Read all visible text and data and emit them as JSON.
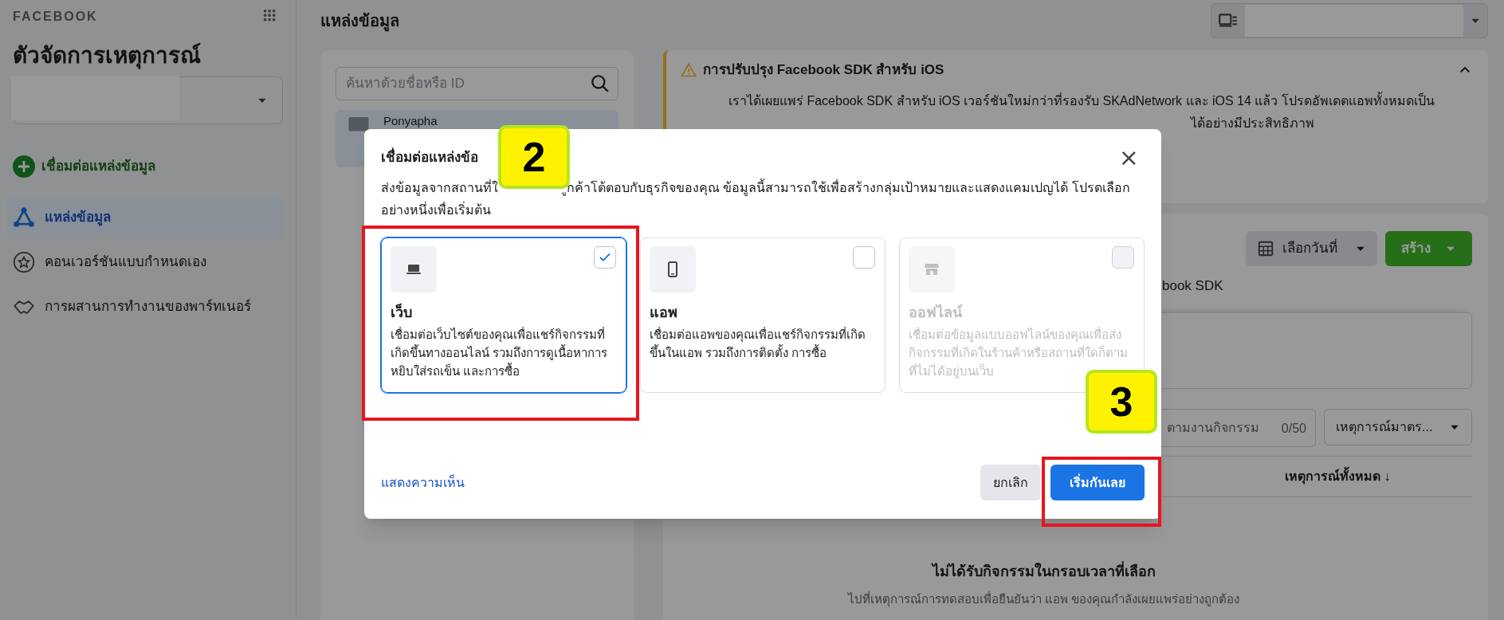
{
  "sidebar": {
    "brand": "FACEBOOK",
    "title": "ตัวจัดการเหตุการณ์",
    "connect_button": "เชื่อมต่อแหล่งข้อมูล",
    "items": [
      {
        "label": "แหล่งข้อมูล",
        "selected": true
      },
      {
        "label": "คอนเวอร์ชันแบบกำหนดเอง",
        "selected": false
      },
      {
        "label": "การผสานการทำงานของพาร์ทเนอร์",
        "selected": false
      }
    ]
  },
  "header": {
    "title": "แหล่งข้อมูล"
  },
  "sources_panel": {
    "search_placeholder": "ค้นหาด้วยชื่อหรือ ID",
    "items": [
      {
        "name": "Ponyapha",
        "selected": true
      }
    ]
  },
  "notice": {
    "title": "การปรับปรุง Facebook SDK สำหรับ iOS",
    "expanded": true,
    "lines": [
      "เราได้เผยแพร่ Facebook SDK สำหรับ iOS เวอร์ชันใหม่กว่าที่รองรับ SKAdNetwork และ iOS 14 แล้ว โปรดอัพเดตแอพทั้งหมดเป็น",
      "ได้อย่างมีประสิทธิภาพ"
    ]
  },
  "toolbar": {
    "date_button": "เลือกวันที่",
    "create_button": "สร้าง"
  },
  "details": {
    "tail_text": "book SDK"
  },
  "activity": {
    "search_placeholder": "ตามงานกิจกรรม",
    "counter": "0/50",
    "filter": "เหตุการณ์มาตร...",
    "column": "เหตุการณ์ทั้งหมด ↓",
    "empty_title": "ไม่ได้รับกิจกรรมในกรอบเวลาที่เลือก",
    "empty_text": "ไปที่เหตุการณ์การทดสอบเพื่อยืนยันว่า แอพ ของคุณกำลังเผยแพร่อย่างถูกต้อง"
  },
  "modal": {
    "title": "เชื่อมต่อแหล่งข้อ",
    "close": "×",
    "description": [
      "ส่งข้อมูลจากสถานที่ใ",
      "ูกค้าโต้ตอบกับธุรกิจของคุณ ข้อมูลนี้สามารถใช้เพื่อสร้างกลุ่มเป้าหมายและแสดงแคมเปญได้ โปรดเลือก",
      "อย่างหนึ่งเพื่อเริ่มต้น"
    ],
    "options": [
      {
        "title": "เว็บ",
        "description": "เชื่อมต่อเว็บไซต์ของคุณเพื่อแชร์กิจกรรมที่เกิดขึ้นทางออนไลน์ รวมถึงการดูเนื้อหาการหยิบใส่รถเข็น และการซื้อ",
        "selected": true,
        "disabled": false
      },
      {
        "title": "แอพ",
        "description": "เชื่อมต่อแอพของคุณเพื่อแชร์กิจกรรมที่เกิดขึ้นในแอพ รวมถึงการติดตั้ง การซื้อ",
        "selected": false,
        "disabled": false
      },
      {
        "title": "ออฟไลน์",
        "description": "เชื่อมต่อข้อมูลแบบออฟไลน์ของคุณเพื่อส่งกิจกรรมที่เกิดในร้านค้าหรือสถานที่ใดก็ตามที่ไม่ได้อยู่บนเว็บ",
        "selected": false,
        "disabled": true
      }
    ],
    "feedback_link": "แสดงความเห็น",
    "cancel_button": "ยกเลิก",
    "start_button": "เริ่มกันเลย"
  },
  "annotations": [
    {
      "number": "2"
    },
    {
      "number": "3"
    }
  ]
}
